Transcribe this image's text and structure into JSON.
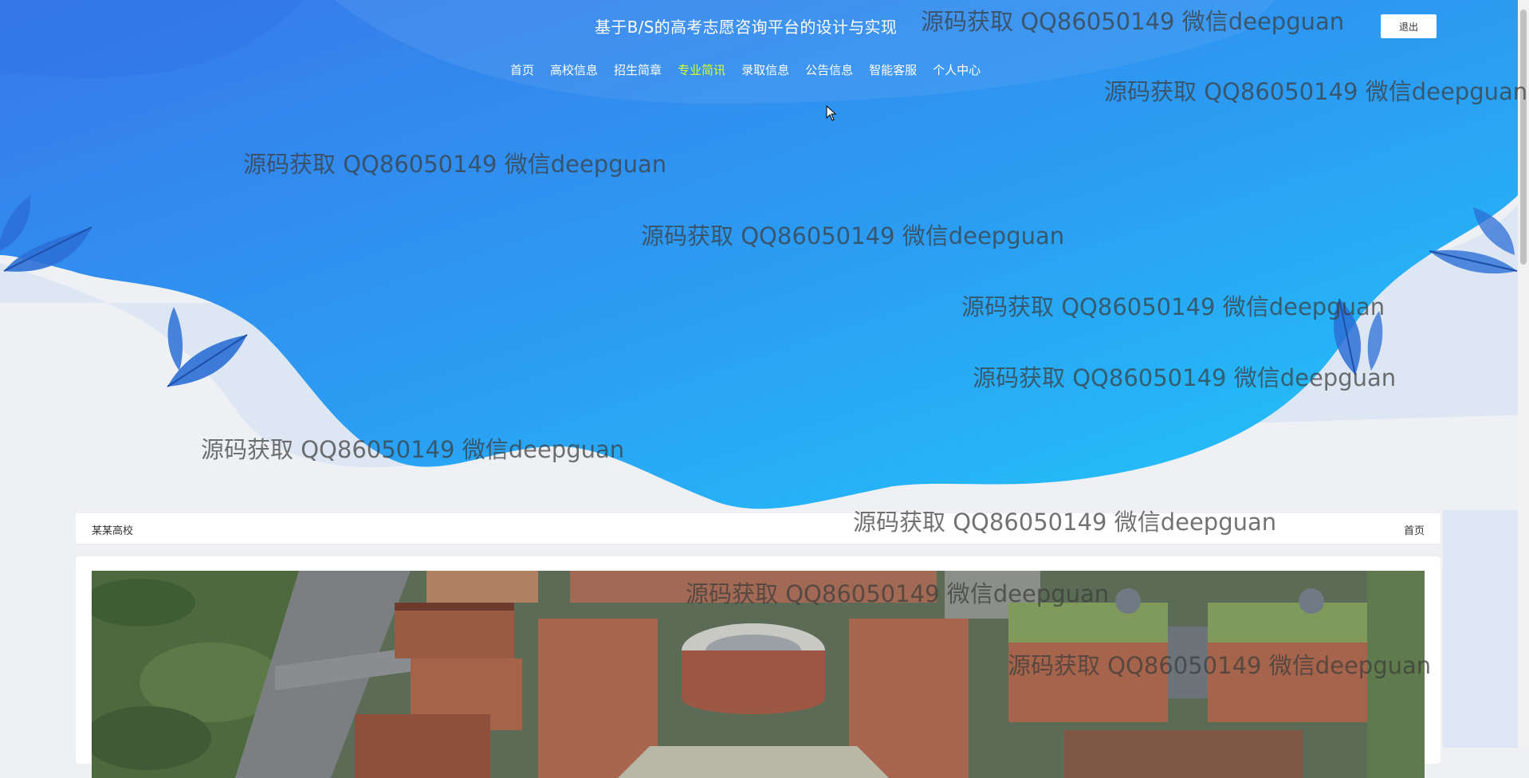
{
  "header": {
    "site_title": "基于B/S的高考志愿咨询平台的设计与实现",
    "logout_label": "退出"
  },
  "nav": {
    "items": [
      {
        "label": "首页"
      },
      {
        "label": "高校信息"
      },
      {
        "label": "招生简章"
      },
      {
        "label": "专业简讯"
      },
      {
        "label": "录取信息"
      },
      {
        "label": "公告信息"
      },
      {
        "label": "智能客服"
      },
      {
        "label": "个人中心"
      }
    ],
    "active_label": "专业简讯"
  },
  "breadcrumb": {
    "current": "某某高校",
    "home_link": "首页"
  },
  "watermark_text": "源码获取 QQ86050149 微信deepguan",
  "colors": {
    "hero_gradient_start": "#3a7bea",
    "hero_gradient_end": "#23c4f8",
    "nav_active": "#d4ff36",
    "page_bg": "#eef0f4"
  },
  "icons": {
    "leaf_decor": "leaf-icon",
    "cursor": "cursor-icon"
  }
}
